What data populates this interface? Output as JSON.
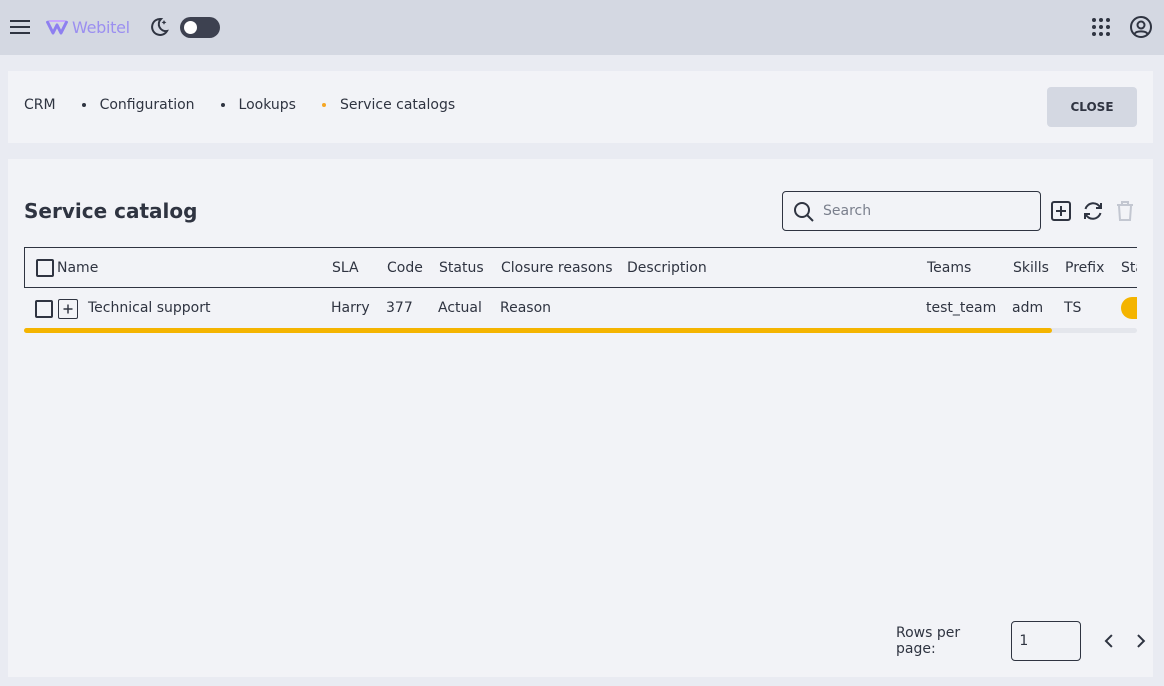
{
  "header": {
    "logo_text": "Webitel",
    "theme_toggle_on": true
  },
  "breadcrumbs": [
    {
      "label": "CRM"
    },
    {
      "label": "Configuration"
    },
    {
      "label": "Lookups"
    },
    {
      "label": "Service catalogs"
    }
  ],
  "actions": {
    "close_label": "CLOSE"
  },
  "catalog": {
    "title": "Service catalog",
    "search_placeholder": "Search",
    "columns": [
      "Name",
      "SLA",
      "Code",
      "Status",
      "Closure reasons",
      "Description",
      "Teams",
      "Skills",
      "Prefix",
      "State"
    ],
    "rows": [
      {
        "name": "Technical support",
        "sla": "Harry",
        "code": "377",
        "status": "Actual",
        "closure_reasons": "Reason",
        "description": "",
        "teams": "test_team",
        "skills": "adm",
        "prefix": "TS",
        "state": true
      }
    ],
    "progress_fraction": 0.924
  },
  "pagination": {
    "rows_per_page_label": "Rows per page:",
    "rows_per_page_value": "1"
  },
  "colors": {
    "accent": "#f4b400",
    "topbar": "#d4d8e2",
    "surface": "#f2f3f7",
    "text": "#2f3441",
    "logo": "#9b8ff0"
  }
}
